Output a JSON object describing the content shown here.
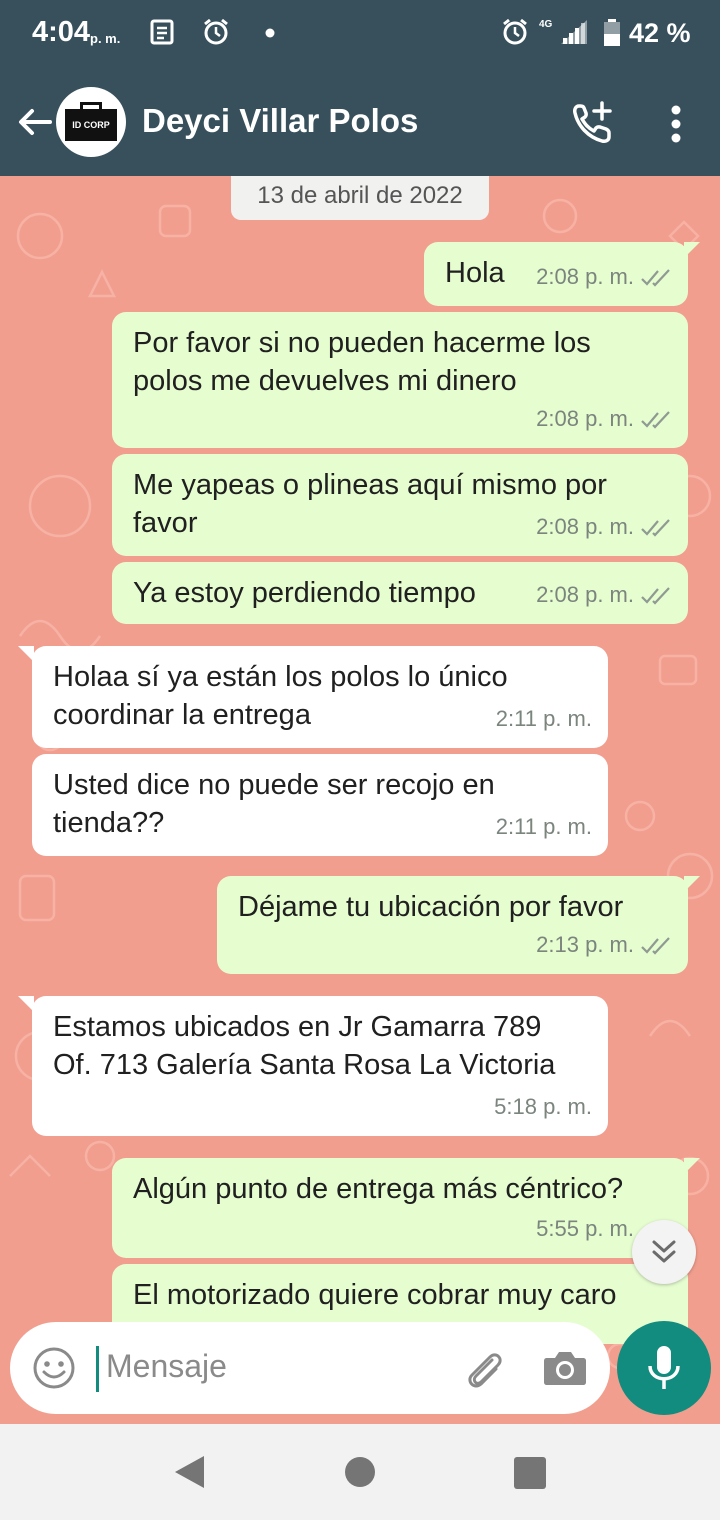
{
  "status_bar": {
    "time": "4:04",
    "ampm": "p. m.",
    "network": "4G",
    "battery": "42 %",
    "icons": [
      "newspaper-icon",
      "alarm-icon",
      "dot-icon",
      "alarm-icon",
      "signal-icon",
      "battery-icon"
    ]
  },
  "header": {
    "contact_name": "Deyci Villar Polos",
    "avatar_text": "ID CORP",
    "icons": [
      "back-arrow-icon",
      "add-call-icon",
      "more-vert-icon"
    ]
  },
  "chat": {
    "date_label": "13 de abril de 2022",
    "messages": [
      {
        "direction": "out",
        "text": "Hola",
        "time": "2:08 p. m.",
        "status": "read"
      },
      {
        "direction": "out",
        "text": "Por favor si no pueden hacerme los polos me devuelves mi dinero",
        "time": "2:08 p. m.",
        "status": "read"
      },
      {
        "direction": "out",
        "text": "Me yapeas o plineas aquí mismo por favor",
        "time": "2:08 p. m.",
        "status": "read"
      },
      {
        "direction": "out",
        "text": "Ya estoy perdiendo tiempo",
        "time": "2:08 p. m.",
        "status": "read"
      },
      {
        "direction": "in",
        "text": "Holaa sí ya están los polos lo único coordinar la entrega",
        "time": "2:11 p. m."
      },
      {
        "direction": "in",
        "text": "Usted dice no puede ser recojo en tienda??",
        "time": "2:11 p. m."
      },
      {
        "direction": "out",
        "text": "Déjame tu ubicación por favor",
        "time": "2:13 p. m.",
        "status": "read"
      },
      {
        "direction": "in",
        "text": "Estamos ubicados en Jr Gamarra 789 Of. 713 Galería Santa Rosa La Victoria",
        "time": "5:18 p. m."
      },
      {
        "direction": "out",
        "text": "Algún punto de entrega más céntrico?",
        "time": "5:55 p. m.",
        "status": "read"
      },
      {
        "direction": "out",
        "text": "El motorizado quiere cobrar muy caro",
        "time": "",
        "status": ""
      }
    ]
  },
  "composer": {
    "placeholder": "Mensaje",
    "icons": [
      "emoji-icon",
      "attach-icon",
      "camera-icon",
      "mic-icon"
    ]
  },
  "colors": {
    "header_bg": "#37505c",
    "chat_bg": "#f29e8e",
    "outgoing_bubble": "#e6fdd0",
    "incoming_bubble": "#ffffff",
    "read_ticks": "#8f9a92",
    "accent": "#128c7e"
  }
}
